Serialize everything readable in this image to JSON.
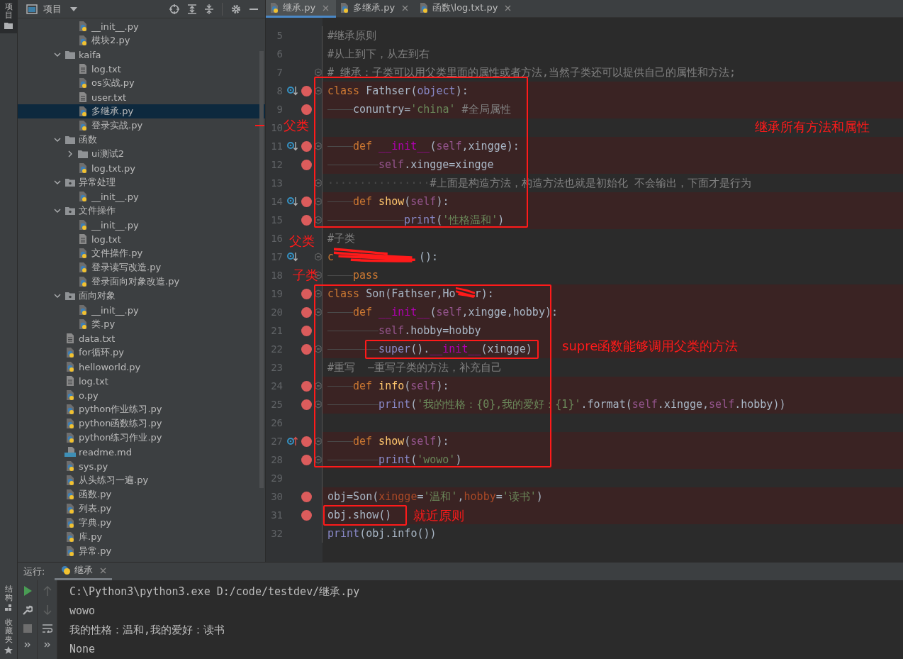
{
  "tool_strip": {
    "top": [
      {
        "label": "项目",
        "selected": true
      }
    ],
    "bottom": [
      {
        "label": "结构",
        "kind": "structure"
      },
      {
        "label": "收藏夹",
        "kind": "favorites"
      }
    ]
  },
  "project": {
    "title": "项目",
    "tree": [
      {
        "kind": "continued",
        "children": [
          {
            "kind": "py",
            "label": "__init__.py",
            "selected": false
          },
          {
            "kind": "py",
            "label": "模块2.py",
            "selected": false
          }
        ]
      },
      {
        "kind": "folder",
        "label": "kaifa",
        "expanded": true,
        "selected": false,
        "children": [
          {
            "kind": "txt",
            "label": "log.txt",
            "selected": false
          },
          {
            "kind": "py",
            "label": "os实战.py",
            "selected": false
          },
          {
            "kind": "txt",
            "label": "user.txt",
            "selected": false
          },
          {
            "kind": "py",
            "label": "多继承.py",
            "selected": true
          },
          {
            "kind": "py",
            "label": "登录实战.py",
            "selected": false
          }
        ]
      },
      {
        "kind": "folder",
        "label": "函数",
        "expanded": true,
        "selected": false,
        "children": [
          {
            "kind": "folder",
            "label": "ui测试2",
            "expanded": false,
            "selected": false
          },
          {
            "kind": "py",
            "label": "log.txt.py",
            "selected": false
          }
        ]
      },
      {
        "kind": "package",
        "label": "异常处理",
        "expanded": true,
        "selected": false,
        "children": [
          {
            "kind": "py",
            "label": "__init__.py",
            "selected": false
          }
        ]
      },
      {
        "kind": "package",
        "label": "文件操作",
        "expanded": true,
        "selected": false,
        "children": [
          {
            "kind": "py",
            "label": "__init__.py",
            "selected": false
          },
          {
            "kind": "txt",
            "label": "log.txt",
            "selected": false
          },
          {
            "kind": "py",
            "label": "文件操作.py",
            "selected": false
          },
          {
            "kind": "py",
            "label": "登录读写改造.py",
            "selected": false
          },
          {
            "kind": "py",
            "label": "登录面向对象改造.py",
            "selected": false
          }
        ]
      },
      {
        "kind": "package",
        "label": "面向对象",
        "expanded": true,
        "selected": false,
        "children": [
          {
            "kind": "py",
            "label": "__init__.py",
            "selected": false
          },
          {
            "kind": "py",
            "label": "类.py",
            "selected": false
          }
        ]
      },
      {
        "kind": "txt",
        "label": "data.txt",
        "selected": false
      },
      {
        "kind": "py",
        "label": "for循环.py",
        "selected": false
      },
      {
        "kind": "py",
        "label": "helloworld.py",
        "selected": false
      },
      {
        "kind": "txt",
        "label": "log.txt",
        "selected": false
      },
      {
        "kind": "py",
        "label": "o.py",
        "selected": false
      },
      {
        "kind": "py",
        "label": "python作业练习.py",
        "selected": false
      },
      {
        "kind": "py",
        "label": "python函数练习.py",
        "selected": false
      },
      {
        "kind": "py",
        "label": "python练习作业.py",
        "selected": false
      },
      {
        "kind": "md",
        "label": "readme.md",
        "selected": false
      },
      {
        "kind": "py",
        "label": "sys.py",
        "selected": false
      },
      {
        "kind": "py",
        "label": "从头练习一遍.py",
        "selected": false
      },
      {
        "kind": "py",
        "label": "函数.py",
        "selected": false
      },
      {
        "kind": "py",
        "label": "列表.py",
        "selected": false
      },
      {
        "kind": "py",
        "label": "字典.py",
        "selected": false
      },
      {
        "kind": "py",
        "label": "库.py",
        "selected": false
      },
      {
        "kind": "py",
        "label": "异常.py",
        "selected": false
      }
    ]
  },
  "editor": {
    "tabs": [
      {
        "label": "继承.py",
        "selected": true
      },
      {
        "label": "多继承.py",
        "selected": false
      },
      {
        "label": "函数\\log.txt.py",
        "selected": false
      }
    ],
    "lines": [
      {
        "number": "5",
        "kind": "plain",
        "breakpoint": false,
        "fold": false,
        "tokens": [
          {
            "kind": "comment",
            "text": "#继承原则"
          }
        ]
      },
      {
        "number": "6",
        "kind": "plain",
        "breakpoint": false,
        "fold": false,
        "tokens": [
          {
            "kind": "comment",
            "text": "#从上到下，从左到右"
          }
        ]
      },
      {
        "number": "7",
        "kind": "plain",
        "breakpoint": false,
        "fold": true,
        "tokens": [
          {
            "kind": "comment",
            "text": "# 继承：子类可以用父类里面的属性或者方法,当然子类还可以提供自己的属性和方法;"
          }
        ]
      },
      {
        "number": "8",
        "kind": "implemented",
        "breakpoint": true,
        "fold": true,
        "tokens": [
          {
            "kind": "keyword",
            "text": "class"
          },
          {
            "kind": "plain",
            "text": " Fathser("
          },
          {
            "kind": "builtin",
            "text": "object"
          },
          {
            "kind": "plain",
            "text": "):"
          }
        ]
      },
      {
        "number": "9",
        "kind": "plain",
        "breakpoint": true,
        "fold": false,
        "tokens": [
          {
            "kind": "tab"
          },
          {
            "kind": "plain",
            "text": "conuntry="
          },
          {
            "kind": "string",
            "text": "'china'"
          },
          {
            "kind": "comment",
            "text": " #全局属性"
          }
        ]
      },
      {
        "number": "10",
        "kind": "plain",
        "breakpoint": false,
        "fold": false
      },
      {
        "number": "11",
        "kind": "implemented",
        "breakpoint": true,
        "fold": true,
        "tokens": [
          {
            "kind": "tab"
          },
          {
            "kind": "keyword",
            "text": "def"
          },
          {
            "kind": "dunder",
            "text": " __init__"
          },
          {
            "kind": "plain",
            "text": "("
          },
          {
            "kind": "self",
            "text": "self"
          },
          {
            "kind": "plain",
            "text": ",xingge):"
          }
        ]
      },
      {
        "number": "12",
        "kind": "plain",
        "breakpoint": true,
        "fold": false,
        "tokens": [
          {
            "kind": "tab"
          },
          {
            "kind": "tab"
          },
          {
            "kind": "self",
            "text": "self"
          },
          {
            "kind": "plain",
            "text": ".xingge=xingge"
          }
        ]
      },
      {
        "number": "13",
        "kind": "plain",
        "breakpoint": false,
        "fold": true,
        "tokens": [
          {
            "kind": "whitespace",
            "text": "················"
          },
          {
            "kind": "comment",
            "text": "#上面是构造方法，构造方法也就是初始化 不会输出，下面才是行为"
          }
        ]
      },
      {
        "number": "14",
        "kind": "implemented",
        "breakpoint": true,
        "fold": true,
        "tokens": [
          {
            "kind": "tab"
          },
          {
            "kind": "keyword",
            "text": "def"
          },
          {
            "kind": "func",
            "text": " show"
          },
          {
            "kind": "plain",
            "text": "("
          },
          {
            "kind": "self",
            "text": "self"
          },
          {
            "kind": "plain",
            "text": "):"
          }
        ]
      },
      {
        "number": "15",
        "kind": "plain",
        "breakpoint": true,
        "fold": true,
        "tokens": [
          {
            "kind": "tab"
          },
          {
            "kind": "tab"
          },
          {
            "kind": "tab"
          },
          {
            "kind": "builtin",
            "text": "print"
          },
          {
            "kind": "plain",
            "text": "("
          },
          {
            "kind": "string",
            "text": "'性格温和'"
          },
          {
            "kind": "plain",
            "text": ")"
          }
        ]
      },
      {
        "number": "16",
        "kind": "plain",
        "breakpoint": false,
        "fold": false,
        "tokens": [
          {
            "kind": "comment",
            "text": "#子类"
          }
        ]
      },
      {
        "number": "17",
        "kind": "implemented",
        "breakpoint": false,
        "fold": true,
        "tokens": [
          {
            "kind": "keyword",
            "text": "c"
          },
          {
            "kind": "scribble-long"
          },
          {
            "kind": "plain",
            "text": "():"
          }
        ]
      },
      {
        "number": "18",
        "kind": "plain",
        "breakpoint": false,
        "fold": true,
        "tokens": [
          {
            "kind": "tab"
          },
          {
            "kind": "keyword",
            "text": "pass"
          }
        ]
      },
      {
        "number": "19",
        "kind": "plain",
        "breakpoint": true,
        "fold": true,
        "tokens": [
          {
            "kind": "keyword",
            "text": "class"
          },
          {
            "kind": "plain",
            "text": " Son(Fathser,Ho"
          },
          {
            "kind": "scribble-short"
          },
          {
            "kind": "plain",
            "text": "r):"
          }
        ]
      },
      {
        "number": "20",
        "kind": "plain",
        "breakpoint": true,
        "fold": true,
        "tokens": [
          {
            "kind": "tab"
          },
          {
            "kind": "keyword",
            "text": "def"
          },
          {
            "kind": "dunder",
            "text": " __init__"
          },
          {
            "kind": "plain",
            "text": "("
          },
          {
            "kind": "self",
            "text": "self"
          },
          {
            "kind": "plain",
            "text": ",xingge,hobby):"
          }
        ]
      },
      {
        "number": "21",
        "kind": "plain",
        "breakpoint": true,
        "fold": false,
        "tokens": [
          {
            "kind": "tab"
          },
          {
            "kind": "tab"
          },
          {
            "kind": "self",
            "text": "self"
          },
          {
            "kind": "plain",
            "text": ".hobby=hobby"
          }
        ]
      },
      {
        "number": "22",
        "kind": "plain",
        "breakpoint": true,
        "fold": true,
        "tokens": [
          {
            "kind": "tab"
          },
          {
            "kind": "tab"
          },
          {
            "kind": "builtin",
            "text": "super"
          },
          {
            "kind": "plain",
            "text": "()."
          },
          {
            "kind": "dunder",
            "text": "__init__"
          },
          {
            "kind": "plain",
            "text": "(xingge)"
          }
        ]
      },
      {
        "number": "23",
        "kind": "plain",
        "breakpoint": false,
        "fold": false,
        "tokens": [
          {
            "kind": "comment",
            "text": "#重写  —重写子类的方法，补充自己"
          }
        ]
      },
      {
        "number": "24",
        "kind": "plain",
        "breakpoint": true,
        "fold": true,
        "tokens": [
          {
            "kind": "tab"
          },
          {
            "kind": "keyword",
            "text": "def"
          },
          {
            "kind": "func",
            "text": " info"
          },
          {
            "kind": "plain",
            "text": "("
          },
          {
            "kind": "self",
            "text": "self"
          },
          {
            "kind": "plain",
            "text": "):"
          }
        ]
      },
      {
        "number": "25",
        "kind": "plain",
        "breakpoint": true,
        "fold": true,
        "tokens": [
          {
            "kind": "tab"
          },
          {
            "kind": "tab"
          },
          {
            "kind": "builtin",
            "text": "print"
          },
          {
            "kind": "plain",
            "text": "("
          },
          {
            "kind": "string",
            "text": "'我的性格：{0},我的爱好：{1}'"
          },
          {
            "kind": "plain",
            "text": ".format("
          },
          {
            "kind": "self",
            "text": "self"
          },
          {
            "kind": "plain",
            "text": ".xingge,"
          },
          {
            "kind": "self",
            "text": "self"
          },
          {
            "kind": "plain",
            "text": ".hobby))"
          }
        ]
      },
      {
        "number": "26",
        "kind": "plain",
        "breakpoint": false,
        "fold": false
      },
      {
        "number": "27",
        "kind": "overrides",
        "breakpoint": true,
        "fold": true,
        "tokens": [
          {
            "kind": "tab"
          },
          {
            "kind": "keyword",
            "text": "def"
          },
          {
            "kind": "func",
            "text": " show"
          },
          {
            "kind": "plain",
            "text": "("
          },
          {
            "kind": "self",
            "text": "self"
          },
          {
            "kind": "plain",
            "text": "):"
          }
        ]
      },
      {
        "number": "28",
        "kind": "plain",
        "breakpoint": true,
        "fold": true,
        "tokens": [
          {
            "kind": "tab"
          },
          {
            "kind": "tab"
          },
          {
            "kind": "builtin",
            "text": "print"
          },
          {
            "kind": "plain",
            "text": "("
          },
          {
            "kind": "string",
            "text": "'wowo'"
          },
          {
            "kind": "plain",
            "text": ")"
          }
        ]
      },
      {
        "number": "29",
        "kind": "plain",
        "breakpoint": false,
        "fold": false
      },
      {
        "number": "30",
        "kind": "plain",
        "breakpoint": true,
        "fold": false,
        "tokens": [
          {
            "kind": "plain",
            "text": "obj=Son("
          },
          {
            "kind": "param",
            "text": "xingge"
          },
          {
            "kind": "plain",
            "text": "="
          },
          {
            "kind": "string",
            "text": "'温和'"
          },
          {
            "kind": "plain",
            "text": ","
          },
          {
            "kind": "param",
            "text": "hobby"
          },
          {
            "kind": "plain",
            "text": "="
          },
          {
            "kind": "string",
            "text": "'读书'"
          },
          {
            "kind": "plain",
            "text": ")"
          }
        ]
      },
      {
        "number": "31",
        "kind": "plain",
        "breakpoint": true,
        "fold": false,
        "tokens": [
          {
            "kind": "plain",
            "text": "obj.show()"
          }
        ]
      },
      {
        "number": "32",
        "kind": "plain",
        "breakpoint": false,
        "fold": false,
        "tokens": [
          {
            "kind": "builtin",
            "text": "print"
          },
          {
            "kind": "plain",
            "text": "(obj.info())"
          }
        ]
      }
    ]
  },
  "annotations": [
    "父类",
    "继承所有方法和属性",
    "父类",
    "子类",
    "supre函数能够调用父类的方法",
    "就近原则"
  ],
  "run": {
    "label": "运行:",
    "tab": {
      "label": "继承",
      "selected": true
    },
    "output": [
      "C:\\Python3\\python3.exe D:/code/testdev/继承.py",
      "wowo",
      "我的性格：温和,我的爱好：读书",
      "None"
    ]
  }
}
